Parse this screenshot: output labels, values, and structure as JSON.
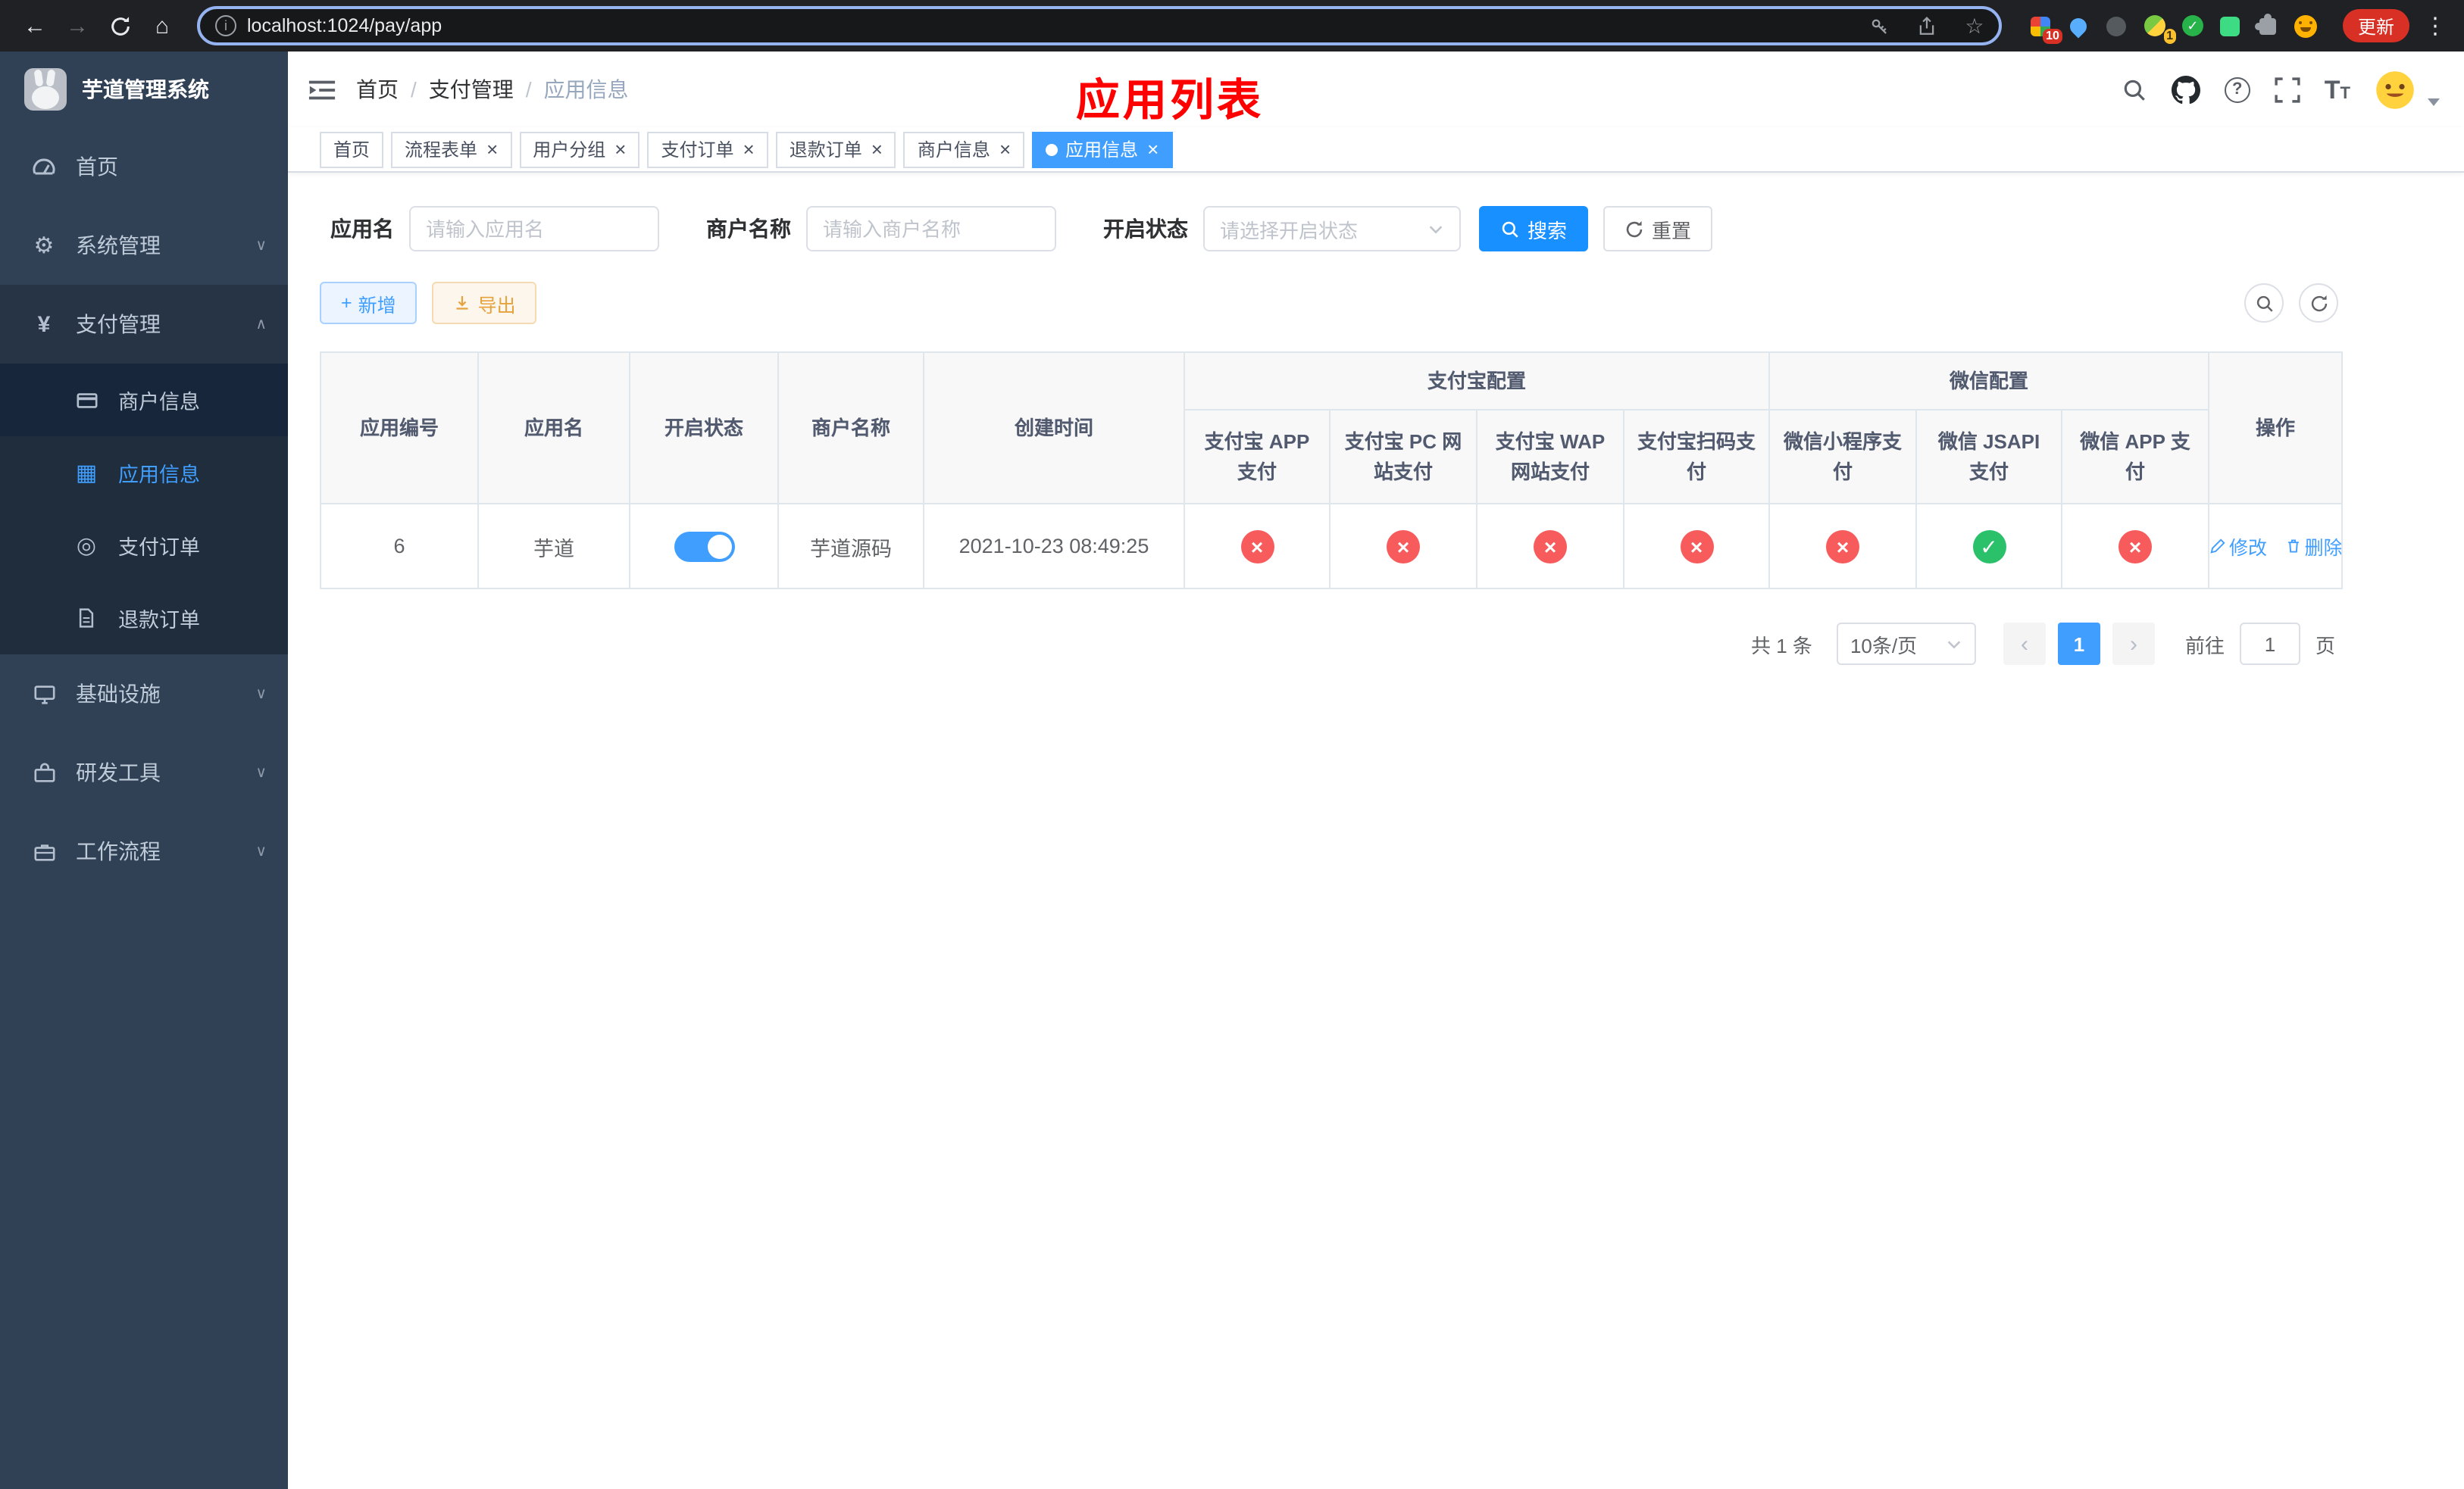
{
  "browser": {
    "url": "localhost:1024/pay/app",
    "update_label": "更新",
    "badge_extensions": "10",
    "badge_profile": "1"
  },
  "sidebar": {
    "logo_title": "芋道管理系统",
    "menu": [
      {
        "label": "首页"
      },
      {
        "label": "系统管理"
      },
      {
        "label": "支付管理"
      },
      {
        "label": "商户信息"
      },
      {
        "label": "应用信息"
      },
      {
        "label": "支付订单"
      },
      {
        "label": "退款订单"
      },
      {
        "label": "基础设施"
      },
      {
        "label": "研发工具"
      },
      {
        "label": "工作流程"
      }
    ]
  },
  "header": {
    "breadcrumb": [
      "首页",
      "支付管理",
      "应用信息"
    ],
    "title": "应用列表"
  },
  "tabs": [
    {
      "label": "首页"
    },
    {
      "label": "流程表单"
    },
    {
      "label": "用户分组"
    },
    {
      "label": "支付订单"
    },
    {
      "label": "退款订单"
    },
    {
      "label": "商户信息"
    },
    {
      "label": "应用信息"
    }
  ],
  "filters": {
    "app_name_label": "应用名",
    "app_name_placeholder": "请输入应用名",
    "merchant_label": "商户名称",
    "merchant_placeholder": "请输入商户名称",
    "status_label": "开启状态",
    "status_placeholder": "请选择开启状态",
    "search_label": "搜索",
    "reset_label": "重置"
  },
  "toolbar": {
    "add_label": "新增",
    "export_label": "导出"
  },
  "table": {
    "group_alipay": "支付宝配置",
    "group_wechat": "微信配置",
    "col_id": "应用编号",
    "col_name": "应用名",
    "col_status": "开启状态",
    "col_merchant": "商户名称",
    "col_created": "创建时间",
    "col_alipay_app": "支付宝 APP 支付",
    "col_alipay_pc": "支付宝 PC 网站支付",
    "col_alipay_wap": "支付宝 WAP 网站支付",
    "col_alipay_qr": "支付宝扫码支付",
    "col_wx_mini": "微信小程序支付",
    "col_wx_jsapi": "微信 JSAPI 支付",
    "col_wx_app": "微信 APP 支付",
    "col_actions": "操作",
    "edit_label": "修改",
    "delete_label": "删除",
    "rows": [
      {
        "id": "6",
        "name": "芋道",
        "status_enabled": true,
        "merchant": "芋道源码",
        "created": "2021-10-23 08:49:25",
        "alipay_app": "disabled",
        "alipay_pc": "disabled",
        "alipay_wap": "disabled",
        "alipay_qr": "disabled",
        "wx_mini": "disabled",
        "wx_jsapi": "enabled",
        "wx_app": "disabled"
      }
    ]
  },
  "pagination": {
    "total_text": "共 1 条",
    "page_size_text": "10条/页",
    "current_page": "1",
    "jump_prefix": "前往",
    "jump_value": "1",
    "jump_suffix": "页"
  },
  "colors": {
    "primary": "#409eff",
    "search_button": "#1890ff",
    "title_red": "#ff0000",
    "success": "#2bc06a",
    "danger": "#f85b5b",
    "warning": "#e6a23c",
    "sidebar_bg": "#304156",
    "submenu_bg": "#1f2d3d"
  }
}
